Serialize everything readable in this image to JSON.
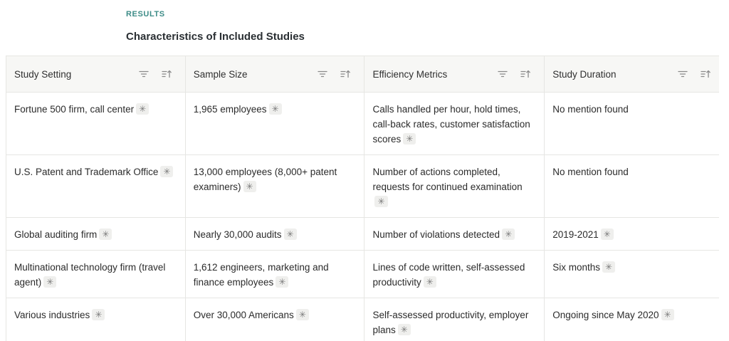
{
  "section": {
    "label": "RESULTS",
    "title": "Characteristics of Included Studies"
  },
  "table": {
    "columns": [
      {
        "label": "Study Setting",
        "icons": [
          "filter-icon",
          "sort-icon"
        ]
      },
      {
        "label": "Sample Size",
        "icons": [
          "filter-icon",
          "sort-icon"
        ]
      },
      {
        "label": "Efficiency Metrics",
        "icons": [
          "filter-icon",
          "sort-icon"
        ]
      },
      {
        "label": "Study Duration",
        "icons": [
          "filter-icon",
          "sort-icon"
        ]
      }
    ],
    "rows": [
      [
        "Fortune 500 firm, call center",
        "1,965 employees",
        "Calls handled per hour, hold times, call-back rates, customer satisfaction scores",
        "No mention found"
      ],
      [
        "U.S. Patent and Trademark Office",
        "13,000 employees (8,000+ patent examiners)",
        "Number of actions completed, requests for continued examination",
        "No mention found"
      ],
      [
        "Global auditing firm",
        "Nearly 30,000 audits",
        "Number of violations detected",
        "2019-2021"
      ],
      [
        "Multinational technology firm (travel agent)",
        "1,612 engineers, marketing and finance employees",
        "Lines of code written, self-assessed productivity",
        "Six months"
      ],
      [
        "Various industries",
        "Over 30,000 Americans",
        "Self-assessed productivity, employer plans",
        "Ongoing since May 2020"
      ]
    ],
    "citation_flags": [
      [
        true,
        true,
        true,
        false
      ],
      [
        true,
        true,
        true,
        false
      ],
      [
        true,
        true,
        true,
        true
      ],
      [
        true,
        true,
        true,
        true
      ],
      [
        true,
        true,
        true,
        true
      ]
    ],
    "citation_marker": "✳"
  },
  "colors": {
    "accent": "#3d8c87",
    "header_bg": "#f7f7f5",
    "border": "#e6e6e3",
    "citation_bg": "#efefed"
  }
}
